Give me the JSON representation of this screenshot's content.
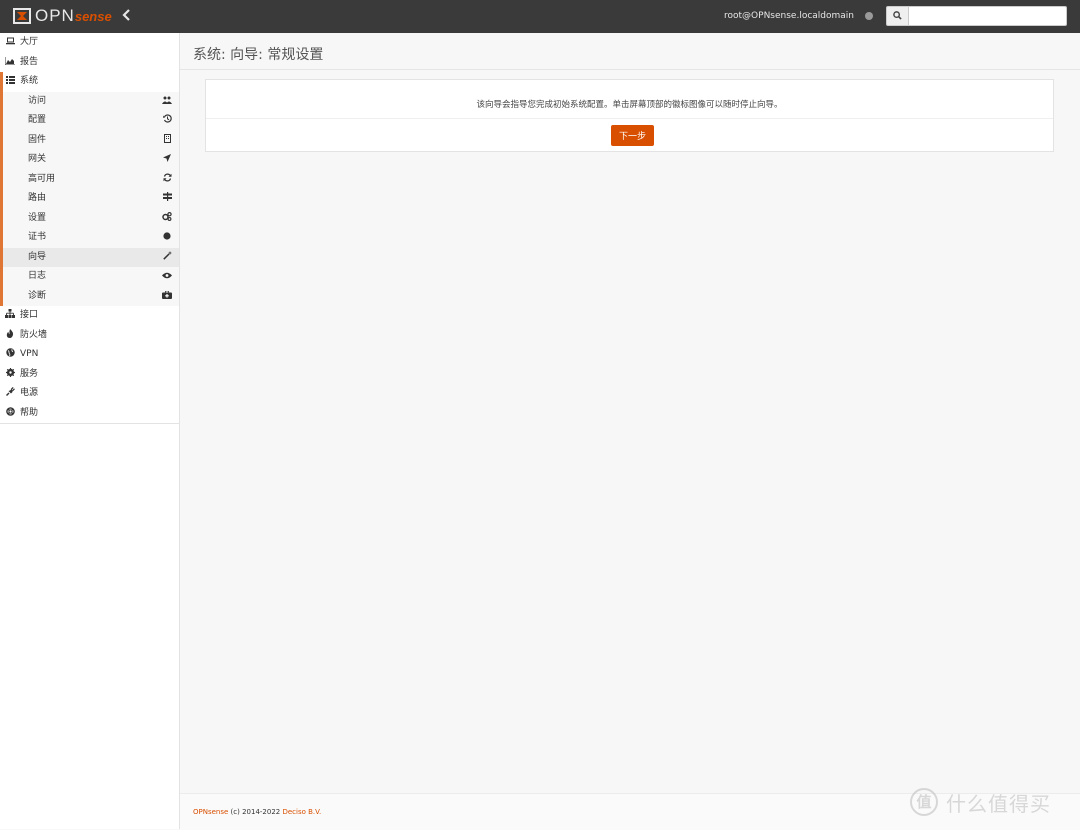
{
  "header": {
    "logo_text_main": "OPN",
    "logo_text_accent": "sense",
    "collapse_icon": "chevron-left-icon",
    "user": "root@OPNsense.localdomain",
    "search_placeholder": ""
  },
  "sidebar": {
    "top_items": [
      {
        "label": "大厅",
        "icon": "laptop-icon"
      },
      {
        "label": "报告",
        "icon": "area-chart-icon"
      },
      {
        "label": "系统",
        "icon": "list-icon"
      }
    ],
    "system_submenu": [
      {
        "label": "访问",
        "icon": "users-icon"
      },
      {
        "label": "配置",
        "icon": "history-icon"
      },
      {
        "label": "固件",
        "icon": "building-icon"
      },
      {
        "label": "网关",
        "icon": "location-arrow-icon"
      },
      {
        "label": "高可用",
        "icon": "refresh-icon"
      },
      {
        "label": "路由",
        "icon": "signpost-icon"
      },
      {
        "label": "设置",
        "icon": "cogs-icon"
      },
      {
        "label": "证书",
        "icon": "certificate-icon"
      },
      {
        "label": "向导",
        "icon": "magic-wand-icon",
        "active": true
      },
      {
        "label": "日志",
        "icon": "eye-icon"
      },
      {
        "label": "诊断",
        "icon": "medkit-icon"
      }
    ],
    "bottom_items": [
      {
        "label": "接口",
        "icon": "sitemap-icon"
      },
      {
        "label": "防火墙",
        "icon": "fire-icon"
      },
      {
        "label": "VPN",
        "icon": "globe-icon"
      },
      {
        "label": "服务",
        "icon": "cog-icon"
      },
      {
        "label": "电源",
        "icon": "plug-icon"
      },
      {
        "label": "帮助",
        "icon": "life-ring-icon"
      }
    ]
  },
  "main": {
    "title": "系统: 向导: 常规设置",
    "intro": "该向导会指导您完成初始系统配置。单击屏幕顶部的徽标图像可以随时停止向导。",
    "next_button": "下一步"
  },
  "footer": {
    "brand": "OPNsense",
    "copyright": "(c) 2014-2022",
    "company": "Deciso B.V."
  },
  "watermark": {
    "glyph": "值",
    "text": "什么值得买"
  },
  "colors": {
    "accent": "#d94f00",
    "topbar": "#3a3a3a"
  }
}
